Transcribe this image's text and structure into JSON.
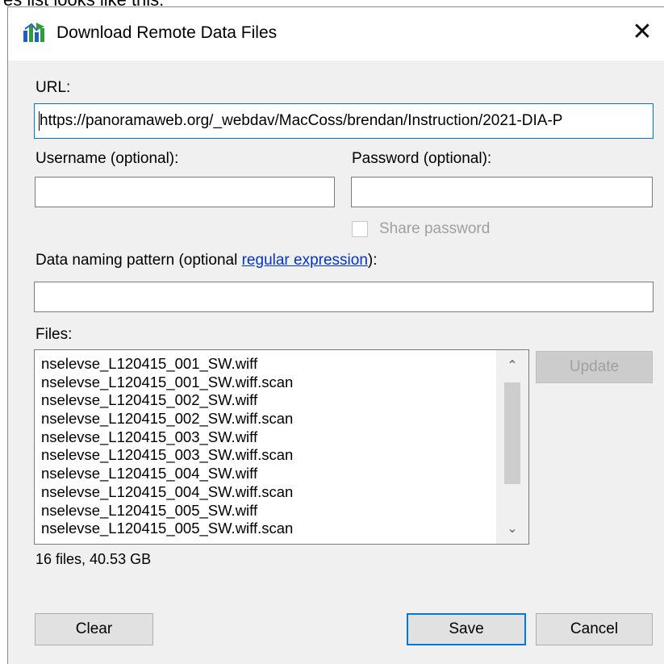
{
  "caption": "es list looks like this:",
  "dialog": {
    "title": "Download Remote Data Files",
    "close_glyph": "✕"
  },
  "form": {
    "url_label": "URL:",
    "url_value": "https://panoramaweb.org/_webdav/MacCoss/brendan/Instruction/2021-DIA-P",
    "username_label": "Username (optional):",
    "username_value": "",
    "password_label": "Password (optional):",
    "password_value": "",
    "share_password_label": "Share password",
    "share_password_checked": false,
    "naming_label_prefix": "Data naming pattern (optional ",
    "naming_link": "regular expression",
    "naming_label_suffix": "):",
    "naming_value": ""
  },
  "files": {
    "label": "Files:",
    "items": [
      "nselevse_L120415_001_SW.wiff",
      "nselevse_L120415_001_SW.wiff.scan",
      "nselevse_L120415_002_SW.wiff",
      "nselevse_L120415_002_SW.wiff.scan",
      "nselevse_L120415_003_SW.wiff",
      "nselevse_L120415_003_SW.wiff.scan",
      "nselevse_L120415_004_SW.wiff",
      "nselevse_L120415_004_SW.wiff.scan",
      "nselevse_L120415_005_SW.wiff",
      "nselevse_L120415_005_SW.wiff.scan"
    ],
    "summary": "16 files, 40.53 GB",
    "scroll_up_glyph": "⌃",
    "scroll_down_glyph": "⌄"
  },
  "buttons": {
    "update": "Update",
    "clear": "Clear",
    "save": "Save",
    "cancel": "Cancel"
  },
  "colors": {
    "accent": "#0078d7",
    "link": "#0033cc",
    "icon_green": "#2e9b3e",
    "icon_blue": "#1f5fbf"
  }
}
